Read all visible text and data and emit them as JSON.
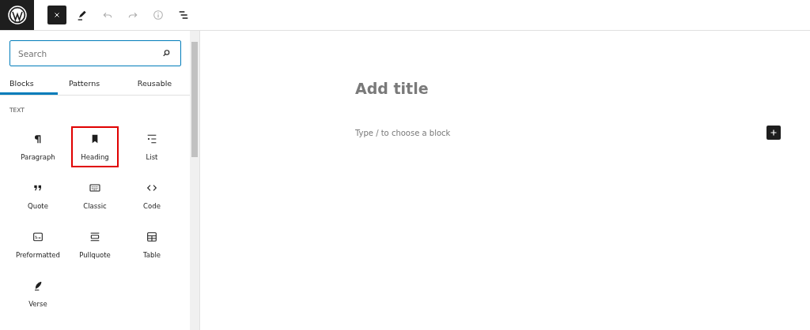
{
  "toolbar": {
    "buttons": [
      {
        "kind": "close",
        "selected": true
      },
      {
        "kind": "edit",
        "selected": false
      },
      {
        "kind": "undo",
        "disabled": true
      },
      {
        "kind": "redo",
        "disabled": true
      },
      {
        "kind": "info",
        "disabled": true
      },
      {
        "kind": "outline",
        "disabled": false
      }
    ]
  },
  "inserter": {
    "search": {
      "placeholder": "Search"
    },
    "tabs": [
      {
        "label": "Blocks",
        "selected": true
      },
      {
        "label": "Patterns",
        "selected": false
      },
      {
        "label": "Reusable",
        "selected": false
      }
    ],
    "category": "TEXT",
    "blocks": [
      {
        "label": "Paragraph",
        "kind": "paragraph",
        "highlighted": false
      },
      {
        "label": "Heading",
        "kind": "heading",
        "highlighted": true
      },
      {
        "label": "List",
        "kind": "list",
        "highlighted": false
      },
      {
        "label": "Quote",
        "kind": "quote",
        "highlighted": false
      },
      {
        "label": "Classic",
        "kind": "classic",
        "highlighted": false
      },
      {
        "label": "Code",
        "kind": "code",
        "highlighted": false
      },
      {
        "label": "Preformatted",
        "kind": "preformatted",
        "highlighted": false
      },
      {
        "label": "Pullquote",
        "kind": "pullquote",
        "highlighted": false
      },
      {
        "label": "Table",
        "kind": "table",
        "highlighted": false
      },
      {
        "label": "Verse",
        "kind": "verse",
        "highlighted": false
      }
    ]
  },
  "editor": {
    "title_placeholder": "Add title",
    "block_placeholder": "Type / to choose a block"
  }
}
